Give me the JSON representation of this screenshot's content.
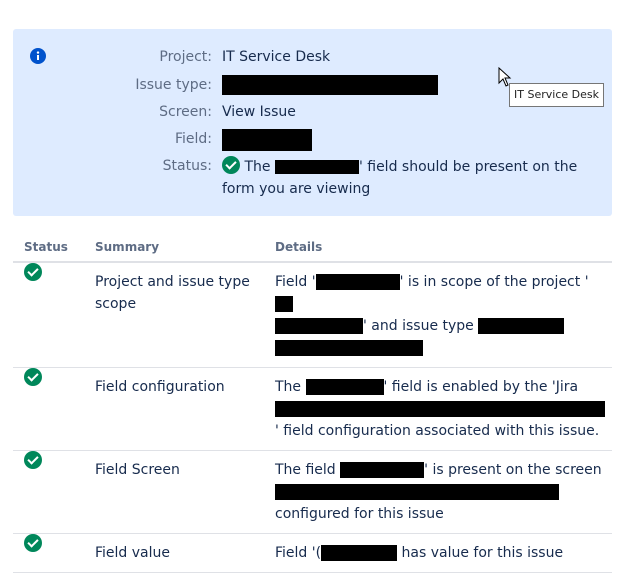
{
  "info": {
    "project_label": "Project:",
    "project_value": "IT Service Desk",
    "issue_type_label": "Issue type:",
    "screen_label": "Screen:",
    "screen_value": "View Issue",
    "field_label": "Field:",
    "status_label": "Status:",
    "status_text_pre": "The",
    "status_text_post": "' field should be present on the form you are viewing",
    "accent_color": "#0052cc"
  },
  "tooltip": "IT Service Desk",
  "table": {
    "headers": [
      "Status",
      "Summary",
      "Details"
    ],
    "rows": [
      {
        "status": "ok",
        "summary": "Project and issue type scope",
        "details_parts": [
          "Field '",
          "' is in scope of the project '",
          "' and issue type "
        ]
      },
      {
        "status": "ok",
        "summary": "Field configuration",
        "details_parts": [
          "The ",
          "' field is enabled by the 'Jira ",
          "' field configuration associated with this issue."
        ]
      },
      {
        "status": "ok",
        "summary": "Field Screen",
        "details_parts": [
          "The field ",
          "' is present on the screen ",
          "configured for this issue"
        ]
      },
      {
        "status": "ok",
        "summary": "Field value",
        "details_parts": [
          "Field '(",
          " has value for this issue"
        ]
      }
    ]
  },
  "colors": {
    "panel_bg": "#deebff",
    "success": "#00875a",
    "muted": "#5e6c84"
  }
}
